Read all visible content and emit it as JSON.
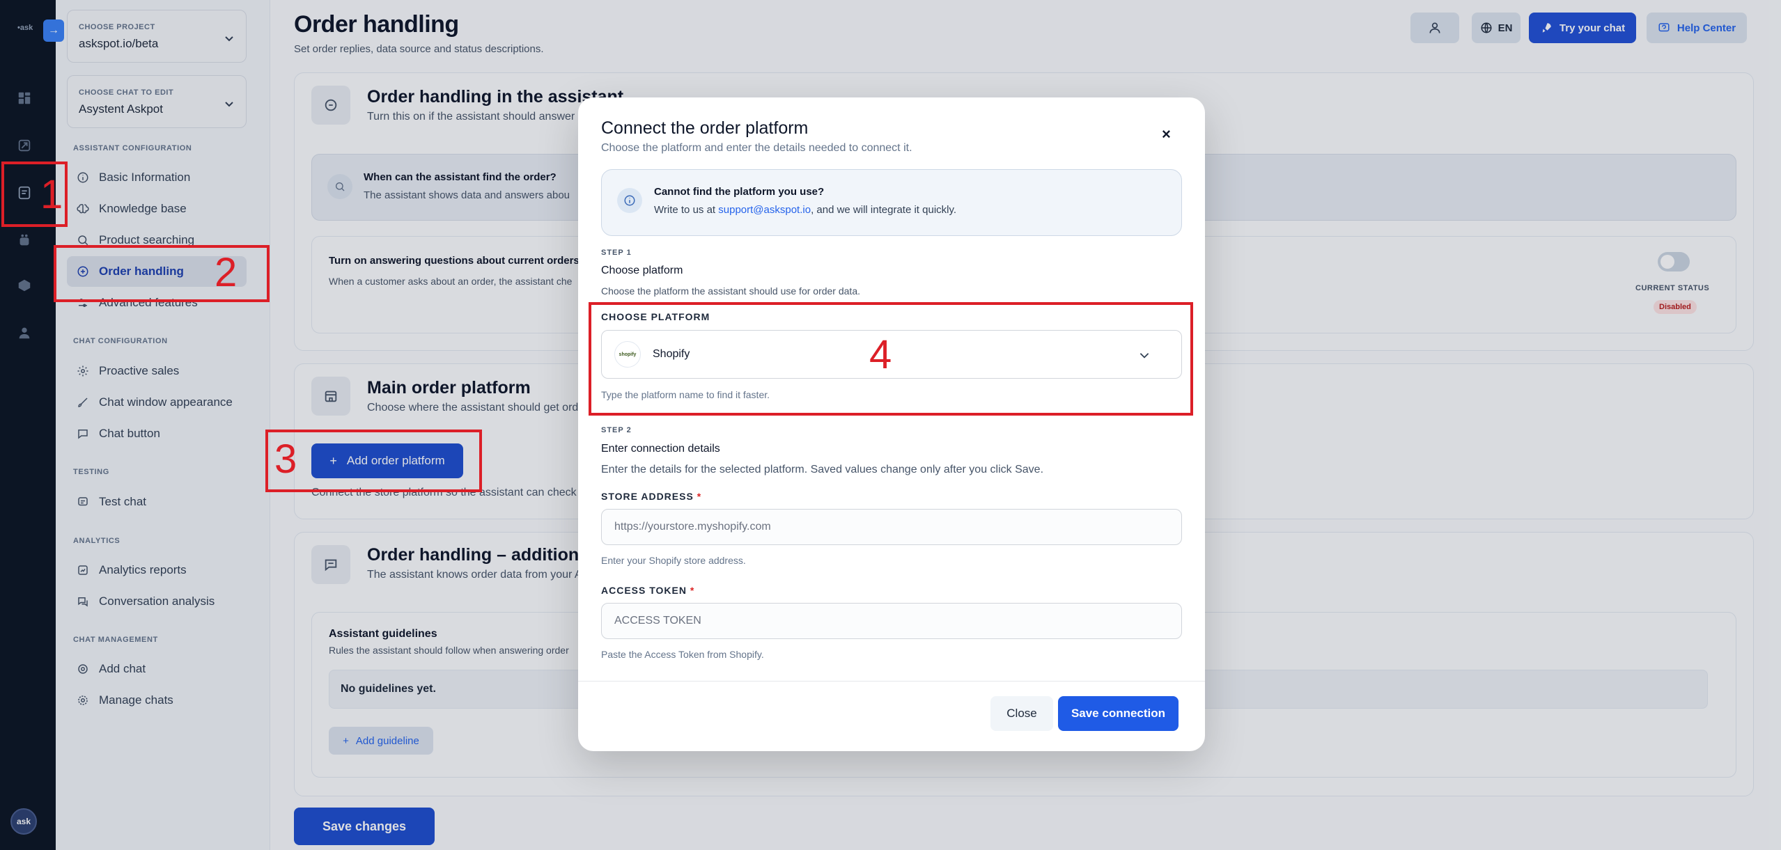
{
  "rail": {
    "logo": "•ask",
    "collapse_glyph": "→",
    "avatar_label": "ask"
  },
  "sidebar": {
    "project_caption": "CHOOSE PROJECT",
    "project_value": "askspot.io/beta",
    "chat_caption": "CHOOSE CHAT TO EDIT",
    "chat_value": "Asystent Askpot",
    "sections": {
      "assistant_config": "ASSISTANT CONFIGURATION",
      "chat_config": "CHAT CONFIGURATION",
      "testing": "TESTING",
      "analytics": "ANALYTICS",
      "chat_management": "CHAT MANAGEMENT"
    },
    "items": {
      "basic_information": "Basic Information",
      "knowledge_base": "Knowledge base",
      "product_searching": "Product searching",
      "order_handling": "Order handling",
      "advanced_features": "Advanced features",
      "proactive_sales": "Proactive sales",
      "chat_window_appearance": "Chat window appearance",
      "chat_button": "Chat button",
      "test_chat": "Test chat",
      "analytics_reports": "Analytics reports",
      "conversation_analysis": "Conversation analysis",
      "add_chat": "Add chat",
      "manage_chats": "Manage chats"
    }
  },
  "header": {
    "title": "Order handling",
    "subtitle": "Set order replies, data source and status descriptions.",
    "lang": "EN",
    "try_chat": "Try your chat",
    "help_center": "Help Center"
  },
  "cards": {
    "assistant": {
      "title": "Order handling in the assistant",
      "subtitle": "Turn this on if the assistant should answer q",
      "find_title": "When can the assistant find the order?",
      "find_text": "The assistant shows data and answers abou",
      "toggle_title": "Turn on answering questions about current orders",
      "toggle_text": "When a customer asks about an order, the assistant che",
      "status_caption": "CURRENT STATUS",
      "status_value": "Disabled"
    },
    "platform": {
      "title": "Main order platform",
      "subtitle": "Choose where the assistant should get orde",
      "add_button": "Add order platform",
      "note": "Connect the store platform so the assistant can check o"
    },
    "additional": {
      "title": "Order handling – additional in",
      "subtitle": "The assistant knows order data from your A",
      "guidelines_title": "Assistant guidelines",
      "guidelines_text": "Rules the assistant should follow when answering order",
      "empty": "No guidelines yet.",
      "add_guideline": "Add guideline"
    }
  },
  "footer": {
    "save_changes": "Save changes"
  },
  "modal": {
    "title": "Connect the order platform",
    "subtitle": "Choose the platform and enter the details needed to connect it.",
    "info_title": "Cannot find the platform you use?",
    "info_prefix": "Write to us at ",
    "info_email": "support@askspot.io",
    "info_suffix": ", and we will integrate it quickly.",
    "step1_caption": "STEP 1",
    "step1_title": "Choose platform",
    "step1_text": "Choose the platform the assistant should use for order data.",
    "platform_caption": "CHOOSE PLATFORM",
    "platform_value": "Shopify",
    "platform_logo": "shopify",
    "platform_hint": "Type the platform name to find it faster.",
    "step2_caption": "STEP 2",
    "step2_title": "Enter connection details",
    "step2_text": "Enter the details for the selected platform. Saved values change only after you click Save.",
    "store_caption": "STORE ADDRESS",
    "store_placeholder": "https://yourstore.myshopify.com",
    "store_hint": "Enter your Shopify store address.",
    "token_caption": "ACCESS TOKEN",
    "token_placeholder": "ACCESS TOKEN",
    "token_hint": "Paste the Access Token from Shopify.",
    "required_mark": "*",
    "close": "Close",
    "save": "Save connection",
    "close_icon": "×"
  },
  "annotations": {
    "n1": "1",
    "n2": "2",
    "n3": "3",
    "n4": "4"
  },
  "colors": {
    "accent": "#2563eb",
    "annotation": "#dc1f27",
    "rail": "#0c1524"
  }
}
